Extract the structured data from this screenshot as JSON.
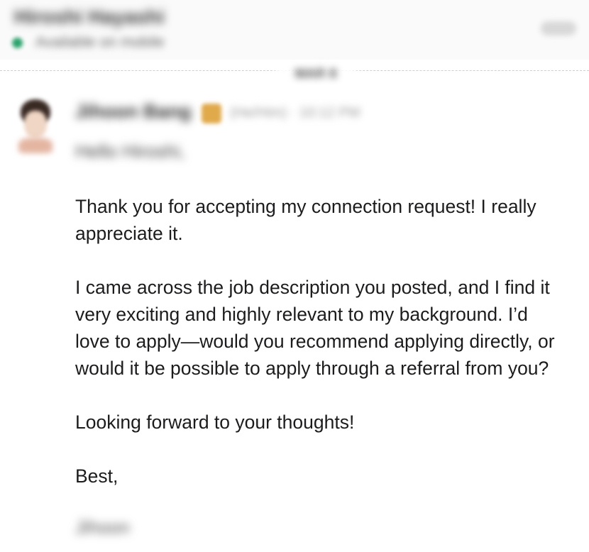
{
  "header": {
    "contact_name": "Hiroshi Hayashi",
    "presence_status": "Available on mobile",
    "menu_icon": "more-options-icon"
  },
  "divider": {
    "date_label": "MAR 8"
  },
  "message": {
    "avatar_icon": "profile-photo",
    "sender_name": "Jihoon Bang",
    "badge_icon": "premium-badge-icon",
    "badge_color": "#e0a94a",
    "sender_meta": "(He/Him) · 10:12 PM",
    "greeting": "Hello Hiroshi,",
    "paragraphs": [
      "Thank you for accepting my connection request! I really appreciate it.",
      "I came across the job description you posted, and I find it very exciting and highly relevant to my background. I’d love to apply—would you recommend applying directly, or would it be possible to apply through a referral from you?",
      "Looking forward to your thoughts!"
    ],
    "closing": "Best,",
    "signature": "Jihoon"
  },
  "colors": {
    "presence_green": "#2aa36b",
    "text": "#1c1c1e",
    "background": "#ffffff"
  }
}
